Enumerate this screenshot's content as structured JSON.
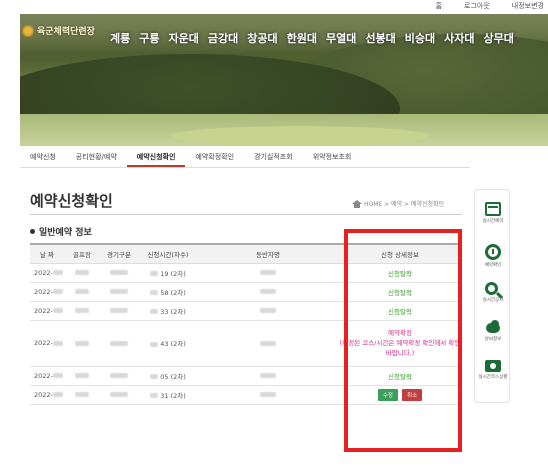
{
  "header": {
    "logo_text": "육군체력단련장",
    "top_links": [
      "홈",
      "로그아웃",
      "내정보변경"
    ],
    "menu": [
      "계룡",
      "구룡",
      "자운대",
      "금강대",
      "창공대",
      "한원대",
      "무열대",
      "선봉대",
      "비승대",
      "사자대",
      "상무대"
    ]
  },
  "subnav": {
    "tabs": [
      "예약신청",
      "공티현황/예약",
      "예약신청확인",
      "예약확정확인",
      "경기실적조회",
      "위약정보조회"
    ],
    "active_index": 2
  },
  "page": {
    "title": "예약신청확인",
    "breadcrumb": "HOME > 예약 > 예약신청확인",
    "section": "일반예약 정보"
  },
  "table": {
    "headers": [
      "날 짜",
      "골프장",
      "경기구분",
      "신청시간(차수)",
      "동반자명",
      "신청 상세정보"
    ],
    "rows": [
      {
        "date": "2022-",
        "time": "19 (2차)",
        "status": "신청탈락",
        "type": "green"
      },
      {
        "date": "2022-",
        "time": "58 (2차)",
        "status": "신청탈락",
        "type": "green"
      },
      {
        "date": "2022-",
        "time": "33 (2차)",
        "status": "신청탈락",
        "type": "green"
      },
      {
        "date": "2022-",
        "time": "43 (2차)",
        "status": "예약확정",
        "note": "(확정된 코스/시간은 예약확정 확인에서 확인바랍니다.)",
        "type": "pink"
      },
      {
        "date": "2022-",
        "time": "05 (2차)",
        "status": "신청탈락",
        "type": "green"
      },
      {
        "date": "2022-",
        "time": "31 (2차)",
        "status": "",
        "type": "buttons",
        "buttons": [
          "수정",
          "취소"
        ]
      }
    ]
  },
  "quick_menu": [
    {
      "label": "실시간예약",
      "icon": "calendar-check-icon"
    },
    {
      "label": "예약확인",
      "icon": "clock-icon"
    },
    {
      "label": "실시간공지",
      "icon": "search-icon"
    },
    {
      "label": "날씨정보",
      "icon": "weather-icon"
    },
    {
      "label": "실시간코스상황",
      "icon": "camera-icon"
    }
  ],
  "colors": {
    "accent": "#c0392b",
    "highlight": "#e82020",
    "green": "#3a9a2c",
    "pink": "#d0308a"
  }
}
